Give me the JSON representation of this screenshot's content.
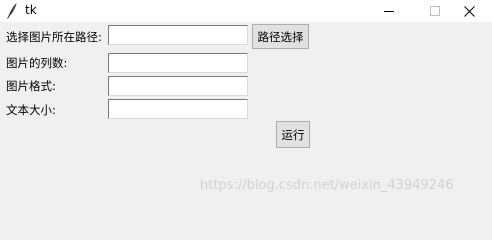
{
  "window": {
    "title": "tk",
    "feather_icon": "tk-feather-icon",
    "minimize_icon": "minimize-icon",
    "maximize_icon": "maximize-icon",
    "close_icon": "close-icon"
  },
  "form": {
    "path_label": "选择图片所在路径:",
    "path_value": "",
    "browse_button": "路径选择",
    "columns_label": "图片的列数:",
    "columns_value": "",
    "format_label": "图片格式:",
    "format_value": "",
    "text_size_label": "文本大小:",
    "text_size_value": "",
    "run_button": "运行"
  },
  "watermark": "https://blog.csdn.net/weixin_43949246"
}
